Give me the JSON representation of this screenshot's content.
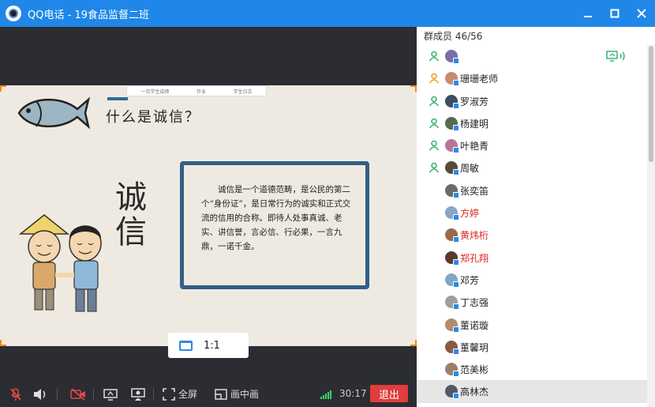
{
  "window": {
    "app_name": "QQ电话",
    "separator": " - ",
    "group_name": "19食品监督二班"
  },
  "slide": {
    "topbar_items": [
      "一页学生成绩",
      "作业",
      "学生日志"
    ],
    "title": "什么是诚信？",
    "big_characters": "诚信",
    "definition": "诚信是一个道德范畴，是公民的第二个“身份证”，是日常行为的诚实和正式交流的信用的合称。即待人处事真诚、老实、讲信誉，言必信、行必果，一言九鼎，一诺千金。"
  },
  "zoom": {
    "ratio": "1:1"
  },
  "toolbar": {
    "fullscreen_label": "全屏",
    "pip_label": "画中画",
    "timer": "30:17",
    "exit_label": "退出"
  },
  "colors": {
    "accent": "#1f87e8",
    "exit": "#e03d3d",
    "speaking": "#e02424",
    "signal": "#39d36a"
  },
  "members": {
    "header_label": "群成员",
    "count": "46/56",
    "items": [
      {
        "name": "",
        "role": "member",
        "sharing": true
      },
      {
        "name": "珊珊老师",
        "role": "owner",
        "sharing": false
      },
      {
        "name": "罗淑芳",
        "role": "member",
        "sharing": false
      },
      {
        "name": "杨建明",
        "role": "member",
        "sharing": false
      },
      {
        "name": "叶艳青",
        "role": "member",
        "sharing": false
      },
      {
        "name": "周敏",
        "role": "member",
        "sharing": false
      },
      {
        "name": "张奕笛",
        "role": "none",
        "sharing": false
      },
      {
        "name": "方婷",
        "role": "none",
        "sharing": false,
        "highlight": true
      },
      {
        "name": "黄炜桁",
        "role": "none",
        "sharing": false,
        "highlight": true
      },
      {
        "name": "郑孔翔",
        "role": "none",
        "sharing": false,
        "highlight": true
      },
      {
        "name": "邓芳",
        "role": "none",
        "sharing": false
      },
      {
        "name": "丁志强",
        "role": "none",
        "sharing": false
      },
      {
        "name": "董诺璇",
        "role": "none",
        "sharing": false
      },
      {
        "name": "董馨玥",
        "role": "none",
        "sharing": false
      },
      {
        "name": "范美彬",
        "role": "none",
        "sharing": false
      },
      {
        "name": "高林杰",
        "role": "none",
        "sharing": false,
        "selected": true
      }
    ]
  }
}
